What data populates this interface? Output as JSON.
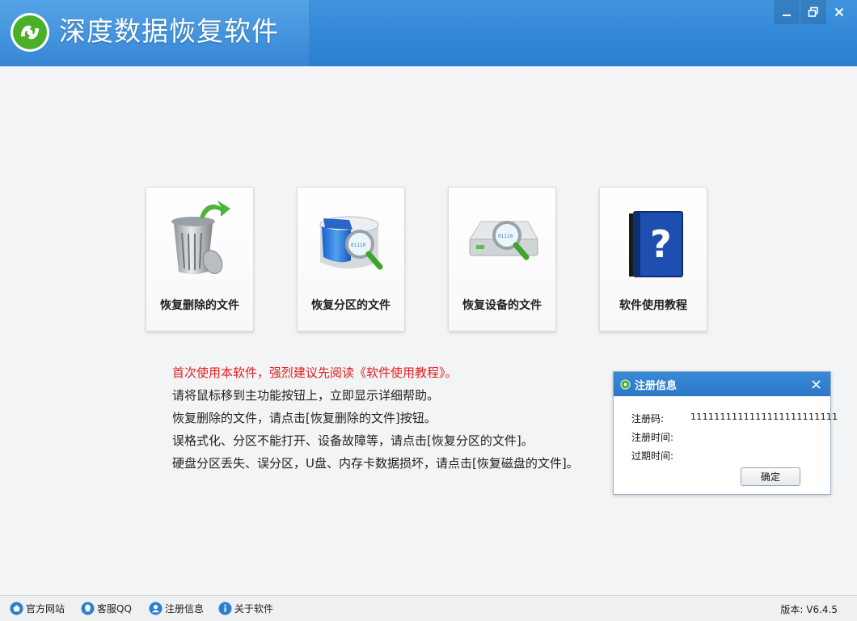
{
  "app": {
    "title": "深度数据恢复软件"
  },
  "window_controls": {
    "minimize": "minimize",
    "restore": "restore",
    "close": "close"
  },
  "tiles": [
    {
      "label": "恢复删除的文件",
      "icon": "recycle-bin-icon"
    },
    {
      "label": "恢复分区的文件",
      "icon": "partition-search-icon"
    },
    {
      "label": "恢复设备的文件",
      "icon": "device-search-icon"
    },
    {
      "label": "软件使用教程",
      "icon": "help-book-icon"
    }
  ],
  "help": {
    "warning": "首次使用本软件，强烈建议先阅读《软件使用教程》。",
    "lines": [
      "请将鼠标移到主功能按钮上，立即显示详细帮助。",
      "恢复删除的文件，请点击[恢复删除的文件]按钮。",
      "误格式化、分区不能打开、设备故障等，请点击[恢复分区的文件]。",
      "硬盘分区丢失、误分区，U盘、内存卡数据损坏，请点击[恢复磁盘的文件]。"
    ]
  },
  "dialog": {
    "title": "注册信息",
    "reg_code_label": "注册码:",
    "reg_code_value": "1111111111111111111111111",
    "reg_time_label": "注册时间:",
    "expire_time_label": "过期时间:",
    "ok_label": "确定"
  },
  "statusbar": {
    "items": [
      {
        "label": "官方网站",
        "icon": "home-icon"
      },
      {
        "label": "客服QQ",
        "icon": "qq-icon"
      },
      {
        "label": "注册信息",
        "icon": "user-icon"
      },
      {
        "label": "关于软件",
        "icon": "info-icon"
      }
    ],
    "version": "版本: V6.4.5"
  },
  "colors": {
    "titlebar": "#2a7fd1",
    "warning_text": "#e02020",
    "background": "#f3f4f6"
  }
}
